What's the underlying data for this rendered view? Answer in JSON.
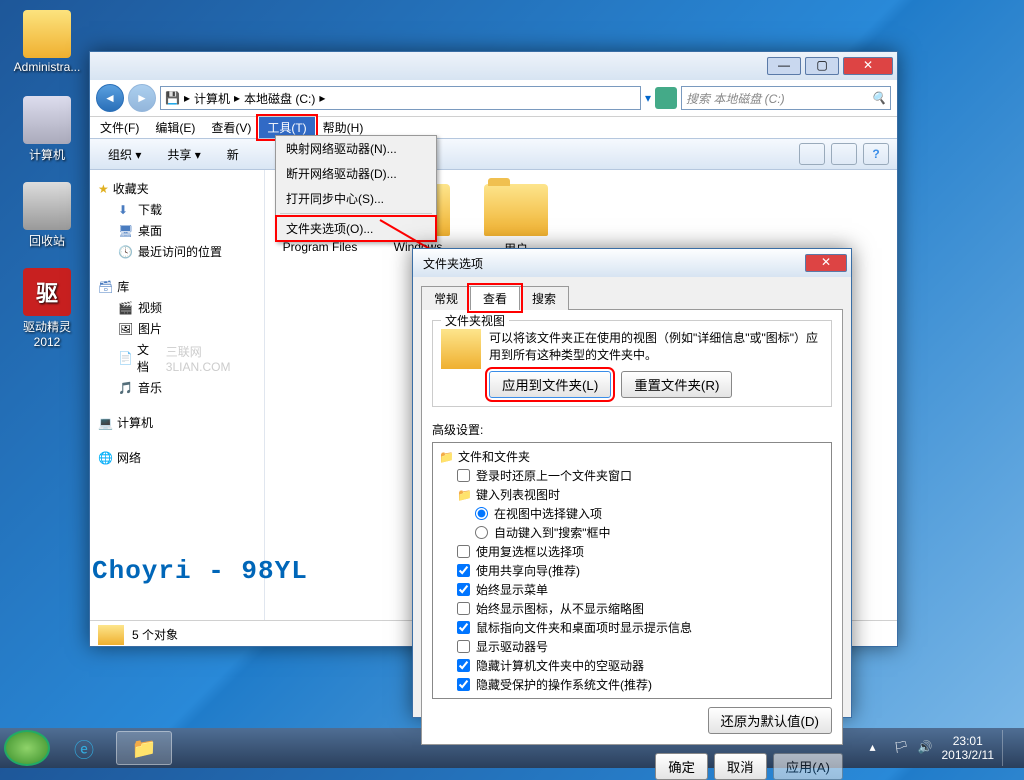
{
  "desktop": {
    "icons": [
      {
        "label": "Administra...",
        "kind": "folder"
      },
      {
        "label": "计算机",
        "kind": "computer"
      },
      {
        "label": "回收站",
        "kind": "bin"
      },
      {
        "label": "驱动精灵2012",
        "kind": "red",
        "glyph": "驱"
      }
    ]
  },
  "explorer": {
    "path": {
      "crumbs": [
        "计算机",
        "本地磁盘 (C:)"
      ]
    },
    "search_placeholder": "搜索 本地磁盘 (C:)",
    "menu": {
      "file": "文件(F)",
      "edit": "编辑(E)",
      "view": "查看(V)",
      "tools": "工具(T)",
      "help": "帮助(H)"
    },
    "toolbar": {
      "organize": "组织 ▾",
      "share": "共享 ▾",
      "new": "新"
    },
    "tools_menu": [
      "映射网络驱动器(N)...",
      "断开网络驱动器(D)...",
      "打开同步中心(S)...",
      "文件夹选项(O)..."
    ],
    "sidebar": {
      "favorites": {
        "head": "收藏夹",
        "items": [
          "下载",
          "桌面",
          "最近访问的位置"
        ]
      },
      "libraries": {
        "head": "库",
        "items": [
          "视频",
          "图片",
          "文档",
          "音乐"
        ]
      },
      "computer": "计算机",
      "network": "网络"
    },
    "folders": [
      "Program Files",
      "Windows",
      "用户"
    ],
    "status": "5 个对象",
    "sidebar_watermark": "三联网 3LIAN.COM"
  },
  "folder_options": {
    "title": "文件夹选项",
    "tabs": {
      "general": "常规",
      "view": "查看",
      "search": "搜索"
    },
    "view": {
      "groupbox_legend": "文件夹视图",
      "desc": "可以将该文件夹正在使用的视图（例如\"详细信息\"或\"图标\"）应用到所有这种类型的文件夹中。",
      "apply_btn": "应用到文件夹(L)",
      "reset_btn": "重置文件夹(R)",
      "advanced_label": "高级设置:",
      "items": [
        {
          "t": "folder",
          "l": "文件和文件夹",
          "i": 0
        },
        {
          "t": "check",
          "c": false,
          "l": "登录时还原上一个文件夹窗口",
          "i": 1
        },
        {
          "t": "folder",
          "l": "键入列表视图时",
          "i": 1
        },
        {
          "t": "radio",
          "c": true,
          "l": "在视图中选择键入项",
          "i": 2
        },
        {
          "t": "radio",
          "c": false,
          "l": "自动键入到\"搜索\"框中",
          "i": 2
        },
        {
          "t": "check",
          "c": false,
          "l": "使用复选框以选择项",
          "i": 1
        },
        {
          "t": "check",
          "c": true,
          "l": "使用共享向导(推荐)",
          "i": 1
        },
        {
          "t": "check",
          "c": true,
          "l": "始终显示菜单",
          "i": 1
        },
        {
          "t": "check",
          "c": false,
          "l": "始终显示图标，从不显示缩略图",
          "i": 1
        },
        {
          "t": "check",
          "c": true,
          "l": "鼠标指向文件夹和桌面项时显示提示信息",
          "i": 1
        },
        {
          "t": "check",
          "c": false,
          "l": "显示驱动器号",
          "i": 1
        },
        {
          "t": "check",
          "c": true,
          "l": "隐藏计算机文件夹中的空驱动器",
          "i": 1
        },
        {
          "t": "check",
          "c": true,
          "l": "隐藏受保护的操作系统文件(推荐)",
          "i": 1
        }
      ],
      "restore_defaults": "还原为默认值(D)"
    },
    "buttons": {
      "ok": "确定",
      "cancel": "取消",
      "apply": "应用(A)"
    }
  },
  "watermark": "Choyri - 98YL",
  "taskbar": {
    "time": "23:01",
    "date": "2013/2/11"
  }
}
